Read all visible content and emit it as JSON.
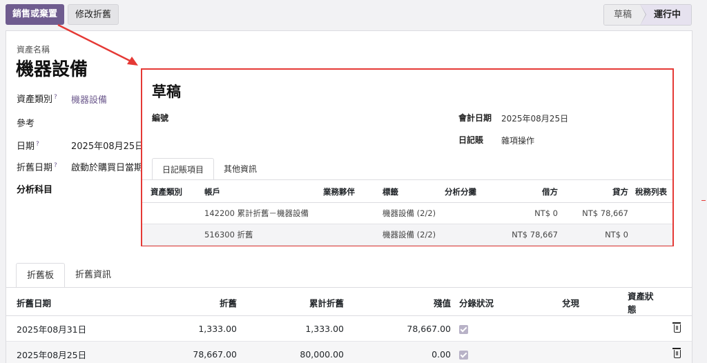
{
  "toolbar": {
    "sell_dispose_label": "銷售或棄置",
    "modify_depreciation_label": "修改折舊"
  },
  "statusbar": {
    "draft_label": "草稿",
    "running_label": "運行中"
  },
  "form": {
    "asset_name_caption": "資產名稱",
    "asset_name": "機器設備",
    "category_label": "資產類別",
    "category_value": "機器設備",
    "reference_label": "參考",
    "date_label": "日期",
    "date_value": "2025年08月25日",
    "depreciation_date_label": "折舊日期",
    "depreciation_date_value": "啟動於購買日當期",
    "analytic_heading": "分析科目",
    "help_mark": "?"
  },
  "notebook": {
    "tabs": [
      {
        "label": "折舊板"
      },
      {
        "label": "折舊資訊"
      }
    ],
    "columns": [
      "折舊日期",
      "折舊",
      "累計折舊",
      "殘值",
      "分錄狀況",
      "兌現",
      "資產狀態"
    ],
    "rows": [
      {
        "date": "2025年08月31日",
        "depreciation": "1,333.00",
        "cumulative": "1,333.00",
        "residual": "78,667.00",
        "posted": true
      },
      {
        "date": "2025年08月25日",
        "depreciation": "78,667.00",
        "cumulative": "80,000.00",
        "residual": "0.00",
        "posted": true
      }
    ]
  },
  "popup": {
    "title": "草稿",
    "number_label": "編號",
    "accounting_date_label": "會計日期",
    "accounting_date_value": "2025年08月25日",
    "journal_label": "日記賬",
    "journal_value": "雜項操作",
    "tabs": [
      {
        "label": "日記賬項目"
      },
      {
        "label": "其他資訊"
      }
    ],
    "columns": [
      "資產類別",
      "帳戶",
      "業務夥伴",
      "標籤",
      "分析分攤",
      "借方",
      "貸方",
      "稅務列表"
    ],
    "lines": [
      {
        "account": "142200 累計折舊－機器設備",
        "label": "機器設備 (2/2)",
        "debit": "NT$ 0",
        "credit": "NT$ 78,667"
      },
      {
        "account": "516300 折舊",
        "label": "機器設備 (2/2)",
        "debit": "NT$ 78,667",
        "credit": "NT$ 0"
      }
    ]
  },
  "colors": {
    "accent": "#6f5c8f",
    "highlight": "#e53935"
  }
}
